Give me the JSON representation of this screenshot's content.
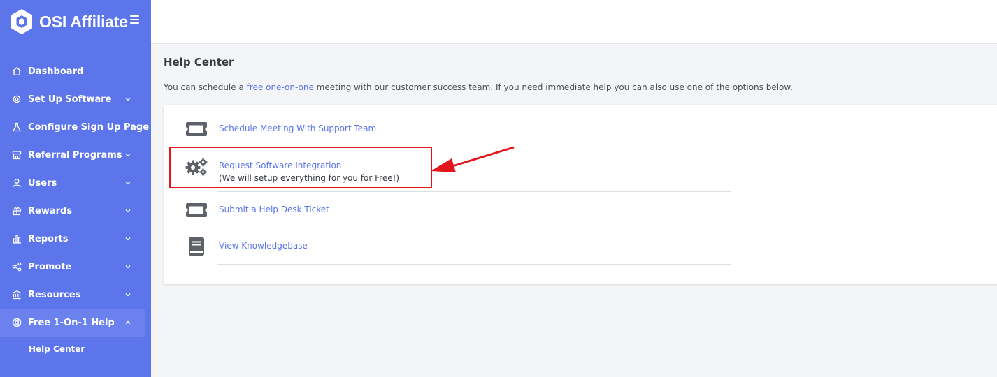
{
  "brand": {
    "name": "OSI Affiliate"
  },
  "nav": [
    {
      "label": "Dashboard",
      "icon": "home-icon",
      "chevron": false
    },
    {
      "label": "Set Up Software",
      "icon": "gear-outline-icon",
      "chevron": true
    },
    {
      "label": "Configure Sign Up Page",
      "icon": "flask-icon",
      "chevron": false
    },
    {
      "label": "Referral Programs",
      "icon": "store-icon",
      "chevron": true
    },
    {
      "label": "Users",
      "icon": "user-icon",
      "chevron": true
    },
    {
      "label": "Rewards",
      "icon": "gift-icon",
      "chevron": true
    },
    {
      "label": "Reports",
      "icon": "bar-chart-icon",
      "chevron": true
    },
    {
      "label": "Promote",
      "icon": "share-icon",
      "chevron": true
    },
    {
      "label": "Resources",
      "icon": "bank-icon",
      "chevron": true
    },
    {
      "label": "Free 1-On-1 Help",
      "icon": "lifebuoy-icon",
      "chevron": true,
      "active": true
    }
  ],
  "nav_sub": {
    "label": "Help Center"
  },
  "page": {
    "title": "Help Center",
    "intro_before": "You can schedule a ",
    "intro_link": "free one-on-one",
    "intro_after": " meeting with our customer success team. If you need immediate help you can also use one of the options below."
  },
  "options": [
    {
      "label": "Schedule Meeting With Support Team",
      "icon": "ticket-icon"
    },
    {
      "label": "Request Software Integration",
      "note": "(We will setup everything for you for Free!)",
      "icon": "gears-icon"
    },
    {
      "label": "Submit a Help Desk Ticket",
      "icon": "ticket-icon"
    },
    {
      "label": "View Knowledgebase",
      "icon": "book-icon"
    }
  ],
  "colors": {
    "sidebar": "#5c75eb",
    "link": "#5c75eb",
    "highlight": "#e3141b"
  }
}
